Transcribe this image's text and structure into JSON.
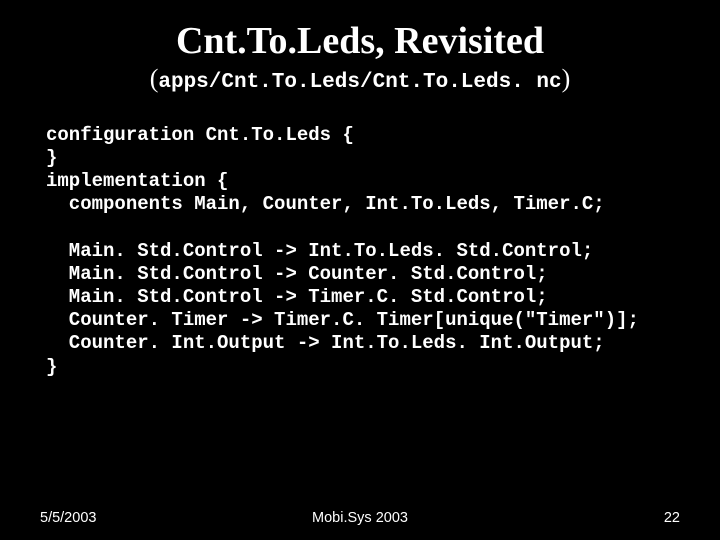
{
  "title": "Cnt.To.Leds, Revisited",
  "subtitle_path": "apps/Cnt.To.Leds/Cnt.To.Leds. nc",
  "code": "configuration Cnt.To.Leds {\n}\nimplementation {\n  components Main, Counter, Int.To.Leds, Timer.C;\n\n  Main. Std.Control -> Int.To.Leds. Std.Control;\n  Main. Std.Control -> Counter. Std.Control;\n  Main. Std.Control -> Timer.C. Std.Control;\n  Counter. Timer -> Timer.C. Timer[unique(\"Timer\")];\n  Counter. Int.Output -> Int.To.Leds. Int.Output;\n}",
  "footer": {
    "date": "5/5/2003",
    "venue": "Mobi.Sys 2003",
    "page": "22"
  }
}
